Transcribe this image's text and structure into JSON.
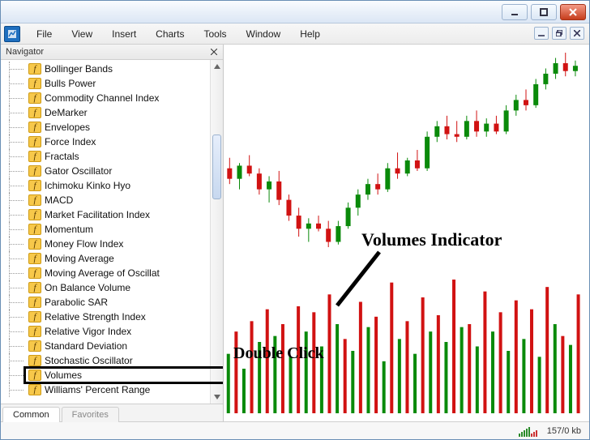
{
  "menu": {
    "items": [
      "File",
      "View",
      "Insert",
      "Charts",
      "Tools",
      "Window",
      "Help"
    ]
  },
  "navigator": {
    "title": "Navigator",
    "tabs": {
      "common": "Common",
      "favorites": "Favorites"
    },
    "indicators": [
      "Bollinger Bands",
      "Bulls Power",
      "Commodity Channel Index",
      "DeMarker",
      "Envelopes",
      "Force Index",
      "Fractals",
      "Gator Oscillator",
      "Ichimoku Kinko Hyo",
      "MACD",
      "Market Facilitation Index",
      "Momentum",
      "Money Flow Index",
      "Moving Average",
      "Moving Average of Oscillat",
      "On Balance Volume",
      "Parabolic SAR",
      "Relative Strength Index",
      "Relative Vigor Index",
      "Standard Deviation",
      "Stochastic Oscillator",
      "Volumes",
      "Williams' Percent Range"
    ],
    "highlighted_index": 21
  },
  "annotations": {
    "volumes_label": "Volumes Indicator",
    "double_click": "Double Click"
  },
  "status": {
    "traffic": "157/0 kb"
  },
  "chart_data": {
    "type": "candlestick+bar",
    "colors": {
      "up": "#0a8a0a",
      "down": "#d11212",
      "annotation_arrow": "#000000"
    },
    "candles": [
      {
        "o": 48,
        "h": 52,
        "l": 42,
        "c": 44,
        "dir": "down"
      },
      {
        "o": 44,
        "h": 50,
        "l": 40,
        "c": 49,
        "dir": "up"
      },
      {
        "o": 49,
        "h": 53,
        "l": 45,
        "c": 46,
        "dir": "down"
      },
      {
        "o": 46,
        "h": 48,
        "l": 38,
        "c": 40,
        "dir": "down"
      },
      {
        "o": 40,
        "h": 45,
        "l": 35,
        "c": 43,
        "dir": "up"
      },
      {
        "o": 43,
        "h": 47,
        "l": 34,
        "c": 36,
        "dir": "down"
      },
      {
        "o": 36,
        "h": 38,
        "l": 28,
        "c": 30,
        "dir": "down"
      },
      {
        "o": 30,
        "h": 33,
        "l": 22,
        "c": 25,
        "dir": "down"
      },
      {
        "o": 25,
        "h": 29,
        "l": 20,
        "c": 27,
        "dir": "up"
      },
      {
        "o": 27,
        "h": 30,
        "l": 24,
        "c": 25,
        "dir": "down"
      },
      {
        "o": 25,
        "h": 28,
        "l": 18,
        "c": 20,
        "dir": "down"
      },
      {
        "o": 20,
        "h": 28,
        "l": 19,
        "c": 26,
        "dir": "up"
      },
      {
        "o": 26,
        "h": 35,
        "l": 25,
        "c": 33,
        "dir": "up"
      },
      {
        "o": 33,
        "h": 40,
        "l": 30,
        "c": 38,
        "dir": "up"
      },
      {
        "o": 38,
        "h": 44,
        "l": 36,
        "c": 42,
        "dir": "up"
      },
      {
        "o": 42,
        "h": 46,
        "l": 38,
        "c": 40,
        "dir": "down"
      },
      {
        "o": 40,
        "h": 50,
        "l": 39,
        "c": 48,
        "dir": "up"
      },
      {
        "o": 48,
        "h": 54,
        "l": 44,
        "c": 46,
        "dir": "down"
      },
      {
        "o": 46,
        "h": 52,
        "l": 45,
        "c": 51,
        "dir": "up"
      },
      {
        "o": 51,
        "h": 55,
        "l": 47,
        "c": 48,
        "dir": "down"
      },
      {
        "o": 48,
        "h": 62,
        "l": 47,
        "c": 60,
        "dir": "up"
      },
      {
        "o": 60,
        "h": 66,
        "l": 58,
        "c": 64,
        "dir": "up"
      },
      {
        "o": 64,
        "h": 68,
        "l": 59,
        "c": 61,
        "dir": "down"
      },
      {
        "o": 61,
        "h": 66,
        "l": 58,
        "c": 60,
        "dir": "down"
      },
      {
        "o": 60,
        "h": 68,
        "l": 59,
        "c": 66,
        "dir": "up"
      },
      {
        "o": 66,
        "h": 70,
        "l": 60,
        "c": 62,
        "dir": "down"
      },
      {
        "o": 62,
        "h": 67,
        "l": 60,
        "c": 65,
        "dir": "up"
      },
      {
        "o": 65,
        "h": 68,
        "l": 61,
        "c": 62,
        "dir": "down"
      },
      {
        "o": 62,
        "h": 72,
        "l": 61,
        "c": 70,
        "dir": "up"
      },
      {
        "o": 70,
        "h": 76,
        "l": 68,
        "c": 74,
        "dir": "up"
      },
      {
        "o": 74,
        "h": 78,
        "l": 70,
        "c": 72,
        "dir": "down"
      },
      {
        "o": 72,
        "h": 82,
        "l": 71,
        "c": 80,
        "dir": "up"
      },
      {
        "o": 80,
        "h": 86,
        "l": 78,
        "c": 84,
        "dir": "up"
      },
      {
        "o": 84,
        "h": 90,
        "l": 82,
        "c": 88,
        "dir": "up"
      },
      {
        "o": 88,
        "h": 92,
        "l": 83,
        "c": 85,
        "dir": "down"
      },
      {
        "o": 85,
        "h": 89,
        "l": 83,
        "c": 87,
        "dir": "up"
      }
    ],
    "volumes": [
      40,
      55,
      30,
      62,
      48,
      70,
      52,
      60,
      38,
      72,
      55,
      68,
      45,
      80,
      60,
      50,
      42,
      75,
      58,
      65,
      35,
      88,
      50,
      62,
      40,
      78,
      55,
      66,
      48,
      90,
      58,
      60,
      45,
      82,
      55,
      68,
      42,
      76,
      50,
      70,
      38,
      85,
      60,
      52,
      46,
      80
    ]
  }
}
